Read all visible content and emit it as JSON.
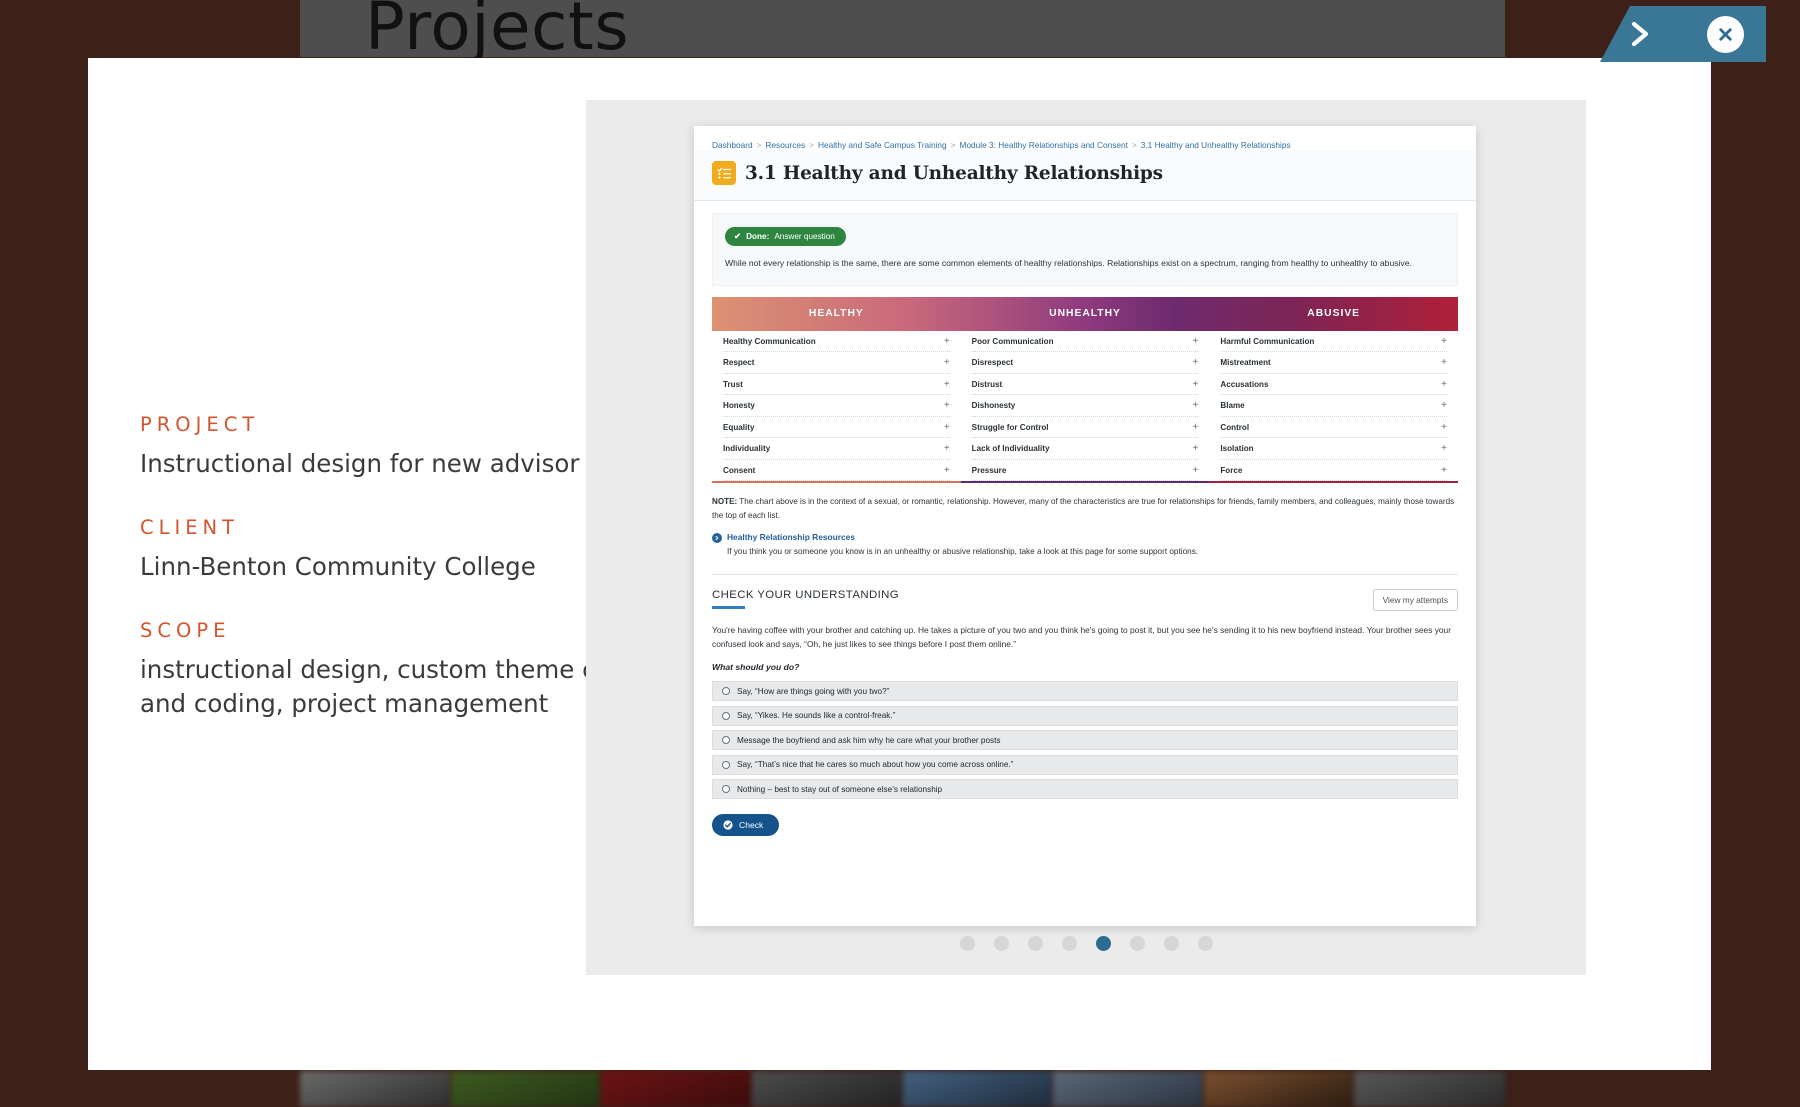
{
  "background": {
    "page_title": "Projects"
  },
  "overlay_controls": {
    "next_label": "next",
    "next_icon": "chevron-right-icon",
    "close_label": "close",
    "close_icon": "close-icon"
  },
  "info": {
    "entries": [
      {
        "label": "PROJECT",
        "value": "Instructional design for new advisor training."
      },
      {
        "label": "CLIENT",
        "value": "Linn-Benton Community College"
      },
      {
        "label": "SCOPE",
        "value": "instructional design, custom theme creation and coding, project management"
      }
    ]
  },
  "screenshot": {
    "breadcrumb": [
      "Dashboard",
      "Resources",
      "Healthy and Safe Campus Training",
      "Module 3: Healthy Relationships and Consent",
      "3.1 Healthy and Unhealthy Relationships"
    ],
    "page_title": "3.1 Healthy and Unhealthy Relationships",
    "title_icon": "checklist-icon",
    "status_badge": {
      "check_icon": "check-icon",
      "state": "Done:",
      "task": "Answer question"
    },
    "intro": "While not every relationship is the same, there are some common elements of healthy relationships. Relationships exist on a spectrum, ranging from healthy to unhealthy to abusive.",
    "spectrum": {
      "headers": [
        "HEALTHY",
        "UNHEALTHY",
        "ABUSIVE"
      ],
      "columns": [
        [
          "Healthy Communication",
          "Respect",
          "Trust",
          "Honesty",
          "Equality",
          "Individuality",
          "Consent"
        ],
        [
          "Poor Communication",
          "Disrespect",
          "Distrust",
          "Dishonesty",
          "Struggle for Control",
          "Lack of Individuality",
          "Pressure"
        ],
        [
          "Harmful Communication",
          "Mistreatment",
          "Accusations",
          "Blame",
          "Control",
          "Isolation",
          "Force"
        ]
      ],
      "expand_symbol": "+",
      "gradient_start": "#dd9272",
      "gradient_mid": "#8e3a7e",
      "gradient_end": "#b02038"
    },
    "note": {
      "label": "NOTE:",
      "text": " The chart above is in the context of a sexual, or romantic, relationship. However, many of the characteristics are true for relationships for friends, family members, and colleagues, mainly those towards the top of each list."
    },
    "resource": {
      "icon": "arrow-right-circle-icon",
      "title": "Healthy Relationship Resources",
      "description": "If you think you or someone you know is in an unhealthy or abusive relationship, take a look at this page for some support options."
    },
    "quiz": {
      "section_title": "CHECK YOUR UNDERSTANDING",
      "attempts_button": "View my attempts",
      "scenario": "You're having coffee with your brother and catching up. He takes a picture of you two and you think he's going to post it, but you see he's sending it to his new boyfriend instead. Your brother sees your confused look and says, “Oh, he just likes to see things before I post them online.”",
      "prompt": "What should you do?",
      "options": [
        "Say, “How are things going with you two?”",
        "Say, “Yikes. He sounds like a control-freak.”",
        "Message the boyfriend and ask him why he care what your brother posts",
        "Say, “That’s nice that he cares so much about how you come across online.”",
        "Nothing – best to stay out of someone else’s relationship"
      ],
      "submit_label": "Check",
      "submit_icon": "check-circle-icon"
    }
  },
  "carousel": {
    "total": 8,
    "active_index": 5
  }
}
